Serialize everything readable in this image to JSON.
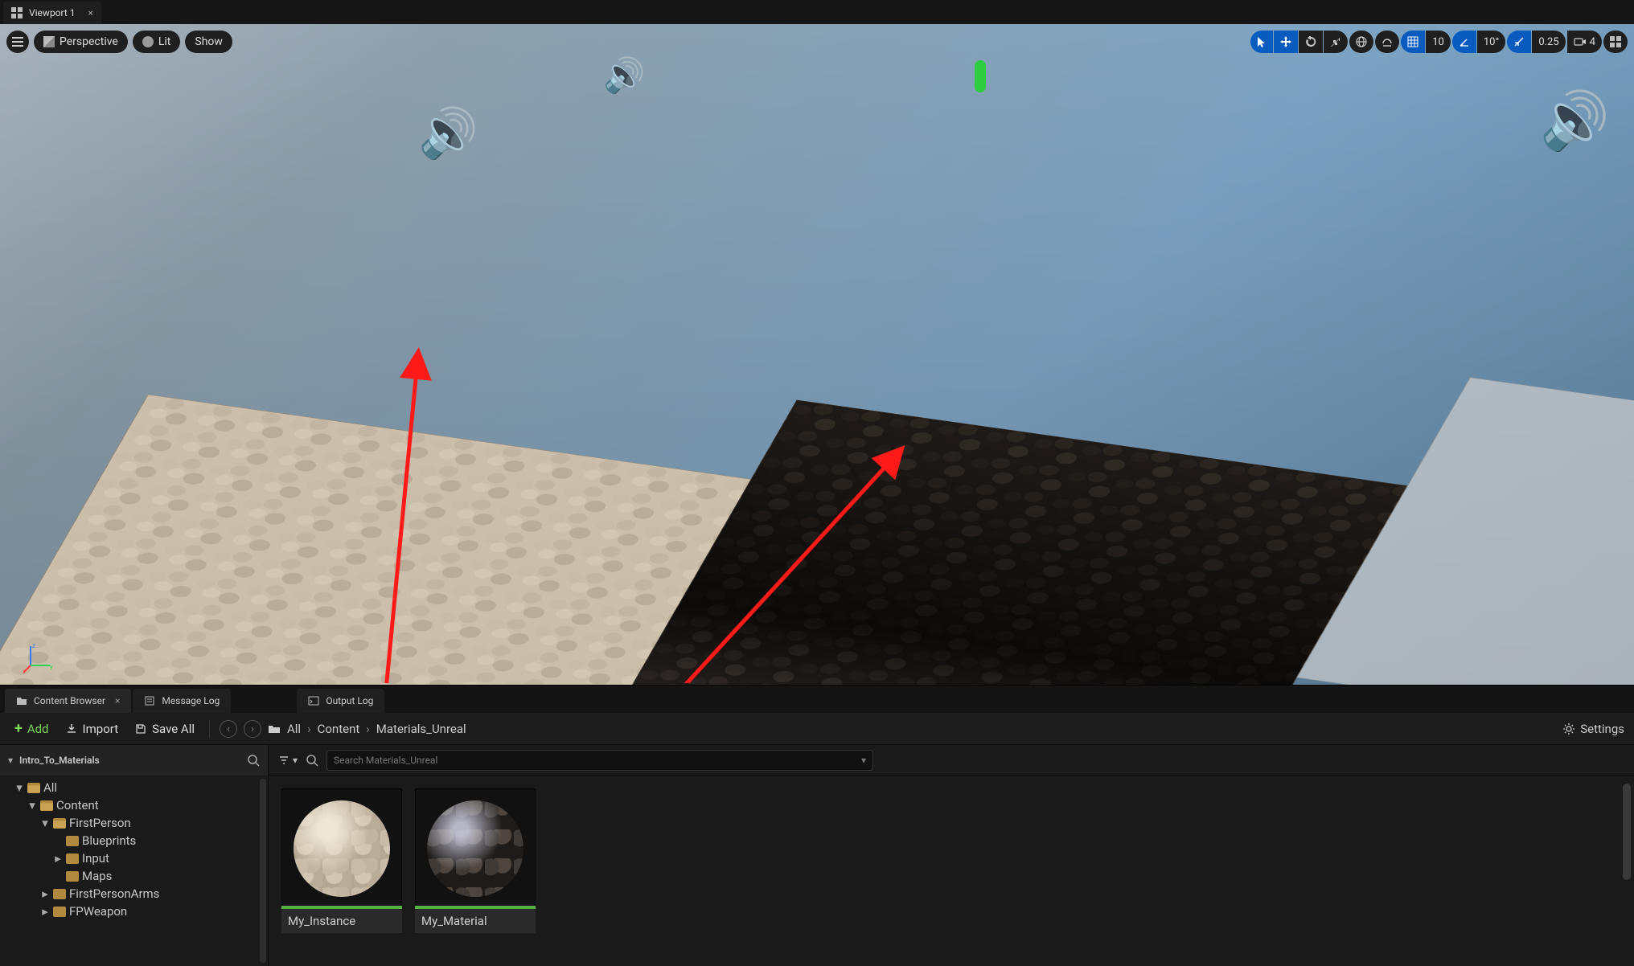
{
  "tabs": {
    "viewport": "Viewport 1"
  },
  "viewport_toolbar": {
    "perspective": "Perspective",
    "lit": "Lit",
    "show": "Show"
  },
  "viewport_right": {
    "grid_value": "10",
    "angle_value": "10°",
    "scale_value": "0.25",
    "camera_value": "4"
  },
  "bottom_tabs": {
    "content": "Content Browser",
    "message": "Message Log",
    "output": "Output Log"
  },
  "cb_bar": {
    "add": "Add",
    "import": "Import",
    "save_all": "Save All",
    "settings": "Settings"
  },
  "breadcrumbs": [
    "All",
    "Content",
    "Materials_Unreal"
  ],
  "sources_header": "Intro_To_Materials",
  "tree": {
    "all": "All",
    "content": "Content",
    "firstperson": "FirstPerson",
    "blueprints": "Blueprints",
    "input": "Input",
    "maps": "Maps",
    "firstpersonarms": "FirstPersonArms",
    "fpweapon": "FPWeapon"
  },
  "search": {
    "placeholder": "Search Materials_Unreal"
  },
  "assets": [
    {
      "name": "My_Instance"
    },
    {
      "name": "My_Material"
    }
  ],
  "gizmo": {
    "x": "x",
    "y": "y",
    "z": "z"
  }
}
